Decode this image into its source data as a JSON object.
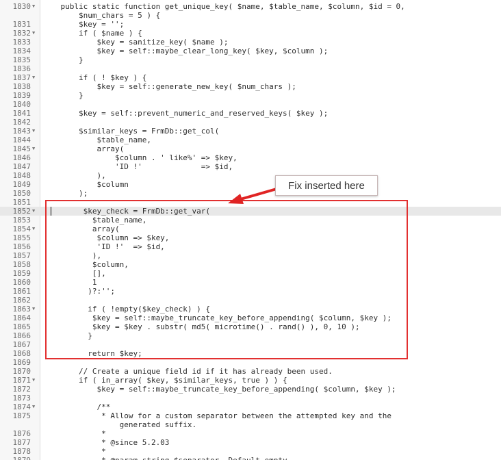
{
  "callout": {
    "text": "Fix inserted here"
  },
  "lines": [
    {
      "num": "1830",
      "fold": true,
      "code": "    public static function get_unique_key( $name, $table_name, $column, $id = 0,"
    },
    {
      "num": "",
      "fold": false,
      "code": "        $num_chars = 5 ) {"
    },
    {
      "num": "1831",
      "fold": false,
      "code": "        $key = '';"
    },
    {
      "num": "1832",
      "fold": true,
      "code": "        if ( $name ) {"
    },
    {
      "num": "1833",
      "fold": false,
      "code": "            $key = sanitize_key( $name );"
    },
    {
      "num": "1834",
      "fold": false,
      "code": "            $key = self::maybe_clear_long_key( $key, $column );"
    },
    {
      "num": "1835",
      "fold": false,
      "code": "        }"
    },
    {
      "num": "1836",
      "fold": false,
      "code": ""
    },
    {
      "num": "1837",
      "fold": true,
      "code": "        if ( ! $key ) {"
    },
    {
      "num": "1838",
      "fold": false,
      "code": "            $key = self::generate_new_key( $num_chars );"
    },
    {
      "num": "1839",
      "fold": false,
      "code": "        }"
    },
    {
      "num": "1840",
      "fold": false,
      "code": ""
    },
    {
      "num": "1841",
      "fold": false,
      "code": "        $key = self::prevent_numeric_and_reserved_keys( $key );"
    },
    {
      "num": "1842",
      "fold": false,
      "code": ""
    },
    {
      "num": "1843",
      "fold": true,
      "code": "        $similar_keys = FrmDb::get_col("
    },
    {
      "num": "1844",
      "fold": false,
      "code": "            $table_name,"
    },
    {
      "num": "1845",
      "fold": true,
      "code": "            array("
    },
    {
      "num": "1846",
      "fold": false,
      "code": "                $column . ' like%' => $key,"
    },
    {
      "num": "1847",
      "fold": false,
      "code": "                'ID !'             => $id,"
    },
    {
      "num": "1848",
      "fold": false,
      "code": "            ),"
    },
    {
      "num": "1849",
      "fold": false,
      "code": "            $column"
    },
    {
      "num": "1850",
      "fold": false,
      "code": "        );"
    },
    {
      "num": "1851",
      "fold": false,
      "code": ""
    },
    {
      "num": "1852",
      "fold": true,
      "code": "         $key_check = FrmDb::get_var("
    },
    {
      "num": "1853",
      "fold": false,
      "code": "           $table_name,"
    },
    {
      "num": "1854",
      "fold": true,
      "code": "           array("
    },
    {
      "num": "1855",
      "fold": false,
      "code": "            $column => $key,"
    },
    {
      "num": "1856",
      "fold": false,
      "code": "            'ID !'  => $id,"
    },
    {
      "num": "1857",
      "fold": false,
      "code": "           ),"
    },
    {
      "num": "1858",
      "fold": false,
      "code": "           $column,"
    },
    {
      "num": "1859",
      "fold": false,
      "code": "           [],"
    },
    {
      "num": "1860",
      "fold": false,
      "code": "           1"
    },
    {
      "num": "1861",
      "fold": false,
      "code": "          )?:'';"
    },
    {
      "num": "1862",
      "fold": false,
      "code": ""
    },
    {
      "num": "1863",
      "fold": true,
      "code": "          if ( !empty($key_check) ) {"
    },
    {
      "num": "1864",
      "fold": false,
      "code": "           $key = self::maybe_truncate_key_before_appending( $column, $key );"
    },
    {
      "num": "1865",
      "fold": false,
      "code": "           $key = $key . substr( md5( microtime() . rand() ), 0, 10 );"
    },
    {
      "num": "1866",
      "fold": false,
      "code": "          }"
    },
    {
      "num": "1867",
      "fold": false,
      "code": ""
    },
    {
      "num": "1868",
      "fold": false,
      "code": "          return $key;"
    },
    {
      "num": "1869",
      "fold": false,
      "code": ""
    },
    {
      "num": "1870",
      "fold": false,
      "code": "        // Create a unique field id if it has already been used."
    },
    {
      "num": "1871",
      "fold": true,
      "code": "        if ( in_array( $key, $similar_keys, true ) ) {"
    },
    {
      "num": "1872",
      "fold": false,
      "code": "            $key = self::maybe_truncate_key_before_appending( $column, $key );"
    },
    {
      "num": "1873",
      "fold": false,
      "code": ""
    },
    {
      "num": "1874",
      "fold": true,
      "code": "            /**"
    },
    {
      "num": "1875",
      "fold": false,
      "code": "             * Allow for a custom separator between the attempted key and the"
    },
    {
      "num": "",
      "fold": false,
      "code": "                 generated suffix."
    },
    {
      "num": "1876",
      "fold": false,
      "code": "             *"
    },
    {
      "num": "1877",
      "fold": false,
      "code": "             * @since 5.2.03"
    },
    {
      "num": "1878",
      "fold": false,
      "code": "             *"
    },
    {
      "num": "1879",
      "fold": false,
      "code": "             * @param string $separator. Default empty."
    }
  ]
}
